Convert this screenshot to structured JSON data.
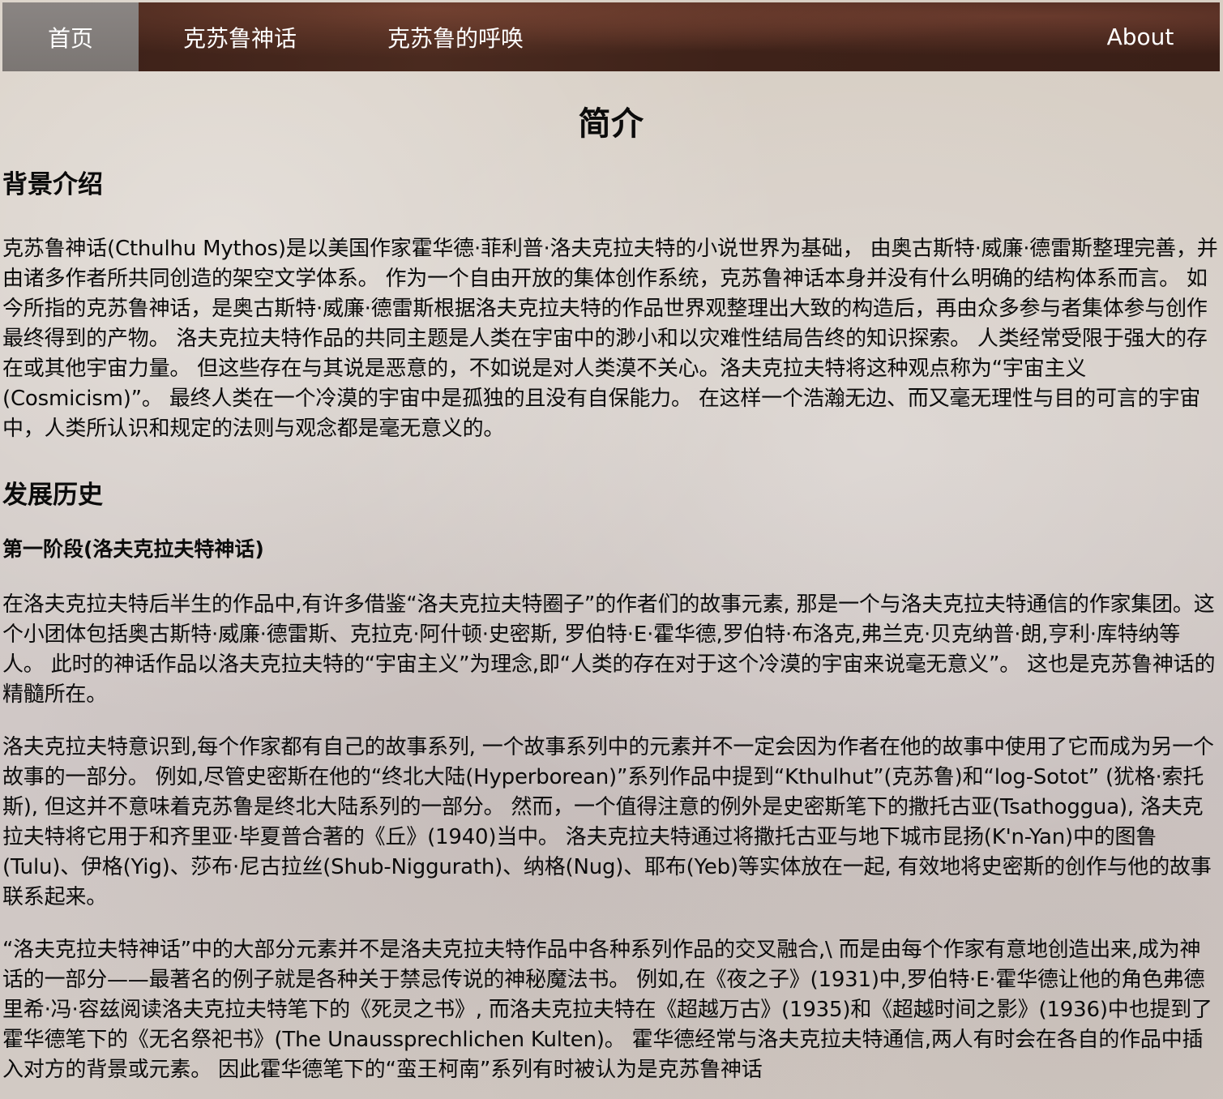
{
  "nav": {
    "items": [
      {
        "label": "首页",
        "active": true
      },
      {
        "label": "克苏鲁神话",
        "active": false
      },
      {
        "label": "克苏鲁的呼唤",
        "active": false
      },
      {
        "label": "About",
        "active": false
      }
    ]
  },
  "main": {
    "title": "简介",
    "sections": {
      "background": {
        "heading": "背景介绍",
        "paragraph": "克苏鲁神话(Cthulhu Mythos)是以美国作家霍华德·菲利普·洛夫克拉夫特的小说世界为基础， 由奥古斯特·威廉·德雷斯整理完善，并由诸多作者所共同创造的架空文学体系。 作为一个自由开放的集体创作系统，克苏鲁神话本身并没有什么明确的结构体系而言。 如今所指的克苏鲁神话，是奥古斯特·威廉·德雷斯根据洛夫克拉夫特的作品世界观整理出大致的构造后，再由众多参与者集体参与创作最终得到的产物。 洛夫克拉夫特作品的共同主题是人类在宇宙中的渺小和以灾难性结局告终的知识探索。 人类经常受限于强大的存在或其他宇宙力量。 但这些存在与其说是恶意的，不如说是对人类漠不关心。洛夫克拉夫特将这种观点称为“宇宙主义(Cosmicism)”。 最终人类在一个冷漠的宇宙中是孤独的且没有自保能力。 在这样一个浩瀚无边、而又毫无理性与目的可言的宇宙中，人类所认识和规定的法则与观念都是毫无意义的。"
      },
      "history": {
        "heading": "发展历史",
        "stage1": {
          "heading": "第一阶段(洛夫克拉夫特神话)",
          "paragraphs": [
            "在洛夫克拉夫特后半生的作品中,有许多借鉴“洛夫克拉夫特圈子”的作者们的故事元素, 那是一个与洛夫克拉夫特通信的作家集团。这个小团体包括奥古斯特·威廉·德雷斯、克拉克·阿什顿·史密斯, 罗伯特·E·霍华德,罗伯特·布洛克,弗兰克·贝克纳普·朗,亨利·库特纳等人。 此时的神话作品以洛夫克拉夫特的“宇宙主义”为理念,即“人类的存在对于这个冷漠的宇宙来说毫无意义”。 这也是克苏鲁神话的精髓所在。",
            "洛夫克拉夫特意识到,每个作家都有自己的故事系列, 一个故事系列中的元素并不一定会因为作者在他的故事中使用了它而成为另一个故事的一部分。 例如,尽管史密斯在他的“终北大陆(Hyperborean)”系列作品中提到“Kthulhut”(克苏鲁)和“log-Sotot” (犹格·索托斯), 但这并不意味着克苏鲁是终北大陆系列的一部分。 然而，一个值得注意的例外是史密斯笔下的撒托古亚(Tsathoggua), 洛夫克拉夫特将它用于和齐里亚·毕夏普合著的《丘》(1940)当中。 洛夫克拉夫特通过将撒托古亚与地下城市昆扬(K'n-Yan)中的图鲁(Tulu)、伊格(Yig)、莎布·尼古拉丝(Shub-Niggurath)、纳格(Nug)、耶布(Yeb)等实体放在一起, 有效地将史密斯的创作与他的故事联系起来。",
            "“洛夫克拉夫特神话”中的大部分元素并不是洛夫克拉夫特作品中各种系列作品的交叉融合,\\ 而是由每个作家有意地创造出来,成为神话的一部分——最著名的例子就是各种关于禁忌传说的神秘魔法书。 例如,在《夜之子》(1931)中,罗伯特·E·霍华德让他的角色弗德里希·冯·容兹阅读洛夫克拉夫特笔下的《死灵之书》, 而洛夫克拉夫特在《超越万古》(1935)和《超越时间之影》(1936)中也提到了霍华德笔下的《无名祭祀书》(The Unaussprechlichen Kulten)。 霍华德经常与洛夫克拉夫特通信,两人有时会在各自的作品中插入对方的背景或元素。 因此霍华德笔下的“蛮王柯南”系列有时被认为是克苏鲁神话"
          ]
        }
      }
    }
  }
}
